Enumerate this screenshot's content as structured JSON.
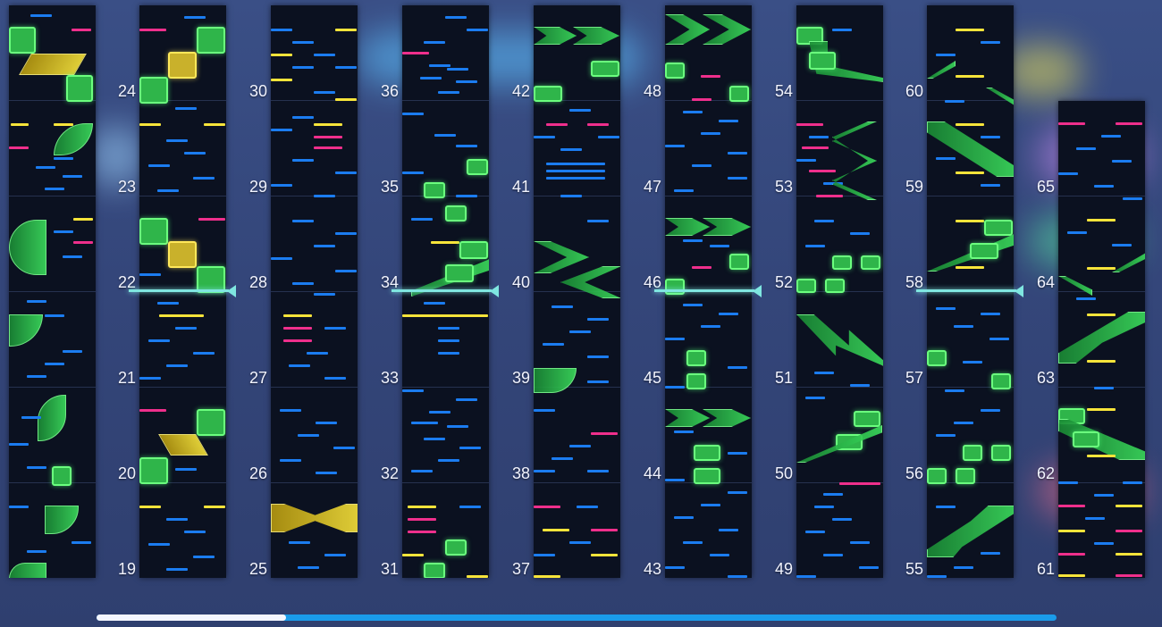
{
  "columns": [
    {
      "labels": [
        "24",
        "23",
        "22",
        "21",
        "20",
        "19"
      ],
      "offset": 0
    },
    {
      "labels": [
        "24",
        "23",
        "22",
        "21",
        "20",
        "19"
      ]
    },
    {
      "labels": [
        "30",
        "29",
        "28",
        "27",
        "26",
        "25"
      ]
    },
    {
      "labels": [
        "36",
        "35",
        "34",
        "33",
        "32",
        "31"
      ]
    },
    {
      "labels": [
        "42",
        "41",
        "40",
        "39",
        "38",
        "37"
      ]
    },
    {
      "labels": [
        "48",
        "47",
        "46",
        "45",
        "44",
        "43"
      ]
    },
    {
      "labels": [
        "54",
        "53",
        "52",
        "51",
        "50",
        "49"
      ]
    },
    {
      "labels": [
        "60",
        "59",
        "58",
        "57",
        "56",
        "55"
      ]
    },
    {
      "labels": [
        "65",
        "64",
        "63",
        "62",
        "61"
      ]
    }
  ],
  "colors": {
    "tap": "#1b7cf0",
    "break": "#f7e43a",
    "ex": "#ef2f8c",
    "hold": "#2fb54a",
    "playhead": "#7fe6e0",
    "scroll_played": "#f4f6ff",
    "scroll_track": "#1a9bea"
  },
  "timeline": {
    "progress": 0.197
  }
}
